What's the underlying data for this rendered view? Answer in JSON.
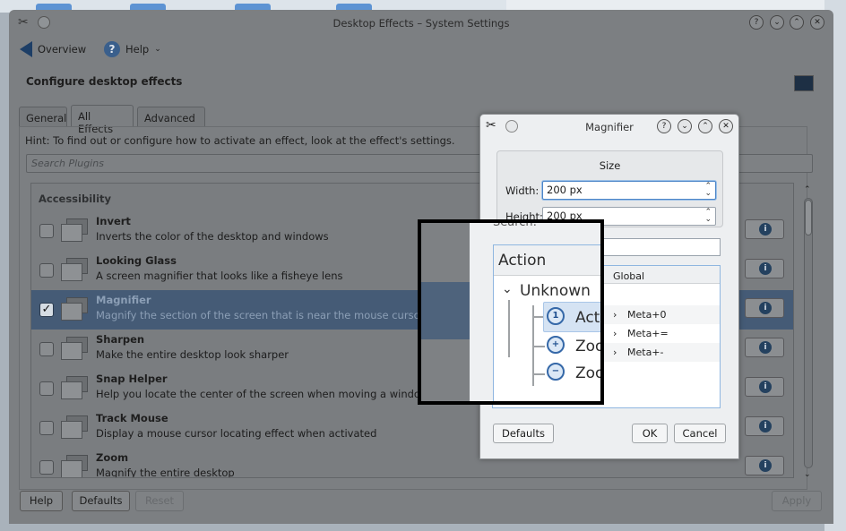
{
  "window": {
    "title": "Desktop Effects – System Settings",
    "icon": "tools-icon"
  },
  "toolbar": {
    "overview_label": "Overview",
    "help_label": "Help"
  },
  "page": {
    "heading": "Configure desktop effects"
  },
  "tabs": [
    "General",
    "All Effects",
    "Advanced"
  ],
  "hint": "Hint: To find out or configure how to activate an effect, look at the effect's settings.",
  "search": {
    "placeholder": "Search Plugins"
  },
  "list": {
    "category": "Accessibility",
    "items": [
      {
        "name": "Invert",
        "description": "Inverts the color of the desktop and windows",
        "checked": false
      },
      {
        "name": "Looking Glass",
        "description": "A screen magnifier that looks like a fisheye lens",
        "checked": false
      },
      {
        "name": "Magnifier",
        "description": "Magnify the section of the screen that is near the mouse cursor",
        "checked": true
      },
      {
        "name": "Sharpen",
        "description": "Make the entire desktop look sharper",
        "checked": false
      },
      {
        "name": "Snap Helper",
        "description": "Help you locate the center of the screen when moving a window.",
        "checked": false
      },
      {
        "name": "Track Mouse",
        "description": "Display a mouse cursor locating effect when activated",
        "checked": false
      },
      {
        "name": "Zoom",
        "description": "Magnify the entire desktop",
        "checked": false
      }
    ]
  },
  "footer": {
    "help": "Help",
    "defaults": "Defaults",
    "reset": "Reset",
    "apply": "Apply"
  },
  "dialog": {
    "title": "Magnifier",
    "group_title": "Size",
    "width_label": "Width:",
    "width_value": "200 px",
    "height_label": "Height:",
    "height_value": "200 px",
    "defaults": "Defaults",
    "ok": "OK",
    "cancel": "Cancel",
    "shortcuts": {
      "global_header": "Global",
      "items": [
        "Meta+0",
        "Meta+=",
        "Meta+-"
      ]
    }
  },
  "lens": {
    "search_fragment": "Search:",
    "action_header": "Action",
    "group": "Unknown",
    "rows": [
      "Actu",
      "Zoo",
      "Zoo"
    ]
  },
  "colors": {
    "selection": "#455b76",
    "info_icon": "#24415f",
    "focus_border": "#4d86c8"
  }
}
